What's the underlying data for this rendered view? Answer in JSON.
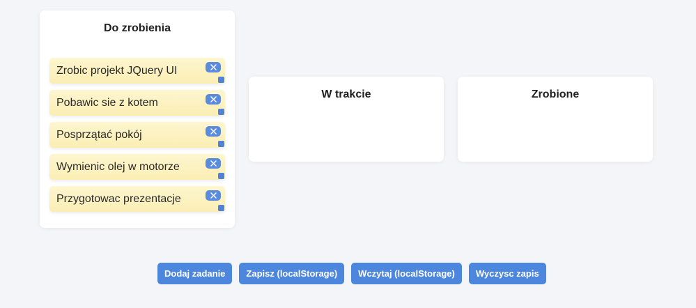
{
  "columns": {
    "todo": {
      "title": "Do zrobienia",
      "tasks": [
        {
          "label": "Zrobic projekt JQuery UI"
        },
        {
          "label": "Pobawic sie z kotem"
        },
        {
          "label": "Posprzątać pokój"
        },
        {
          "label": "Wymienic olej w motorze"
        },
        {
          "label": "Przygotowac prezentacje"
        }
      ]
    },
    "in_progress": {
      "title": "W trakcie",
      "tasks": []
    },
    "done": {
      "title": "Zrobione",
      "tasks": []
    }
  },
  "toolbar": {
    "add_label": "Dodaj zadanie",
    "save_label": "Zapisz (localStorage)",
    "load_label": "Wczytaj (localStorage)",
    "clear_label": "Wyczysc zapis"
  },
  "icons": {
    "task_close": "close-icon",
    "task_handle": "resize-handle-icon"
  },
  "colors": {
    "accent": "#4d86dd",
    "task_bg": "#fbeeb4",
    "column_bg": "#ffffff",
    "page_bg": "#f4f5f9"
  }
}
